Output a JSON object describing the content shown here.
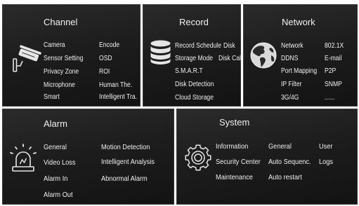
{
  "colors": {
    "page_bg": "#ffffff",
    "tile_bg": "#1c1c1c",
    "text": "#f0f0f0",
    "icon": "#e6e6e6"
  },
  "channel": {
    "title": "Channel",
    "icon": "cctv-camera-icon",
    "items": [
      "Camera",
      "Encode",
      "Sensor Setting",
      "OSD",
      "Privacy Zone",
      "ROI",
      "Microphone",
      "Human The.",
      "Smart",
      "Intelligent Tra."
    ]
  },
  "record": {
    "title": "Record",
    "icon": "database-icon",
    "items": [
      "Record Schedule",
      "Disk",
      "Storage Mode",
      "Disk Cal.",
      "S.M.A.R.T",
      "Disk Detection",
      "Cloud Storage"
    ]
  },
  "network": {
    "title": "Network",
    "icon": "globe-icon",
    "items": [
      "Network",
      "802.1X",
      "DDNS",
      "E-mail",
      "Port Mapping",
      "P2P",
      "IP Filter",
      "SNMP",
      "3G/4G",
      "......"
    ]
  },
  "alarm": {
    "title": "Alarm",
    "icon": "alarm-siren-icon",
    "items": [
      "General",
      "Motion Detection",
      "Video Loss",
      "Intelligent Analysis",
      "Alarm In",
      "Abnormal Alarm",
      "Alarm Out"
    ]
  },
  "system": {
    "title": "System",
    "icon": "gear-icon",
    "items": [
      "Information",
      "General",
      "User",
      "Security Center",
      "Auto Sequenc.",
      "Logs",
      "Maintenance",
      "Auto restart"
    ]
  }
}
